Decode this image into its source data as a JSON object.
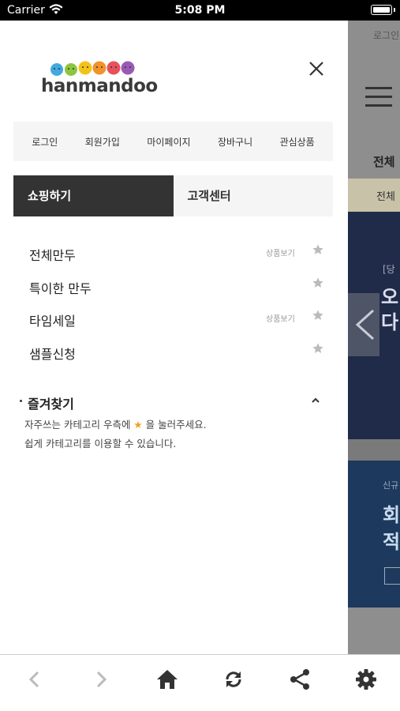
{
  "status_bar": {
    "carrier": "Carrier",
    "time": "5:08 PM"
  },
  "background_page": {
    "login_text": "로그인",
    "tab_text": "전체",
    "strip_text": "전체",
    "banner1_line1": "[당",
    "banner1_line2": "오\n다",
    "banner2_line1": "신규",
    "banner2_line2": "회\n적"
  },
  "logo": {
    "text": "hanmandoo"
  },
  "topnav": {
    "items": [
      "로그인",
      "회원가입",
      "마이페이지",
      "장바구니",
      "관심상품"
    ]
  },
  "tabs": {
    "shopping": "쇼핑하기",
    "customer_center": "고객센터"
  },
  "categories": [
    {
      "label": "전체만두",
      "sub": "상품보기"
    },
    {
      "label": "특이한 만두",
      "sub": ""
    },
    {
      "label": "타임세일",
      "sub": "상품보기"
    },
    {
      "label": "샘플신청",
      "sub": ""
    }
  ],
  "favorites": {
    "title": "즐겨찾기",
    "desc_before_star": "자주쓰는 카테고리 우측에 ",
    "desc_star": "★",
    "desc_after_star": " 을 눌러주세요.",
    "desc_line2": "쉽게 카테고리를 이용할 수 있습니다."
  },
  "icons": {
    "close": "close-icon",
    "star": "star-icon",
    "chevron_up": "chevron-up-icon",
    "back": "back-arrow-icon",
    "forward": "forward-arrow-icon",
    "home": "home-icon",
    "refresh": "refresh-icon",
    "share": "share-icon",
    "settings": "gear-icon"
  },
  "colors": {
    "active_tab": "#333333",
    "accent_star": "#f0a020",
    "icon_gray": "#bbbbbb"
  }
}
